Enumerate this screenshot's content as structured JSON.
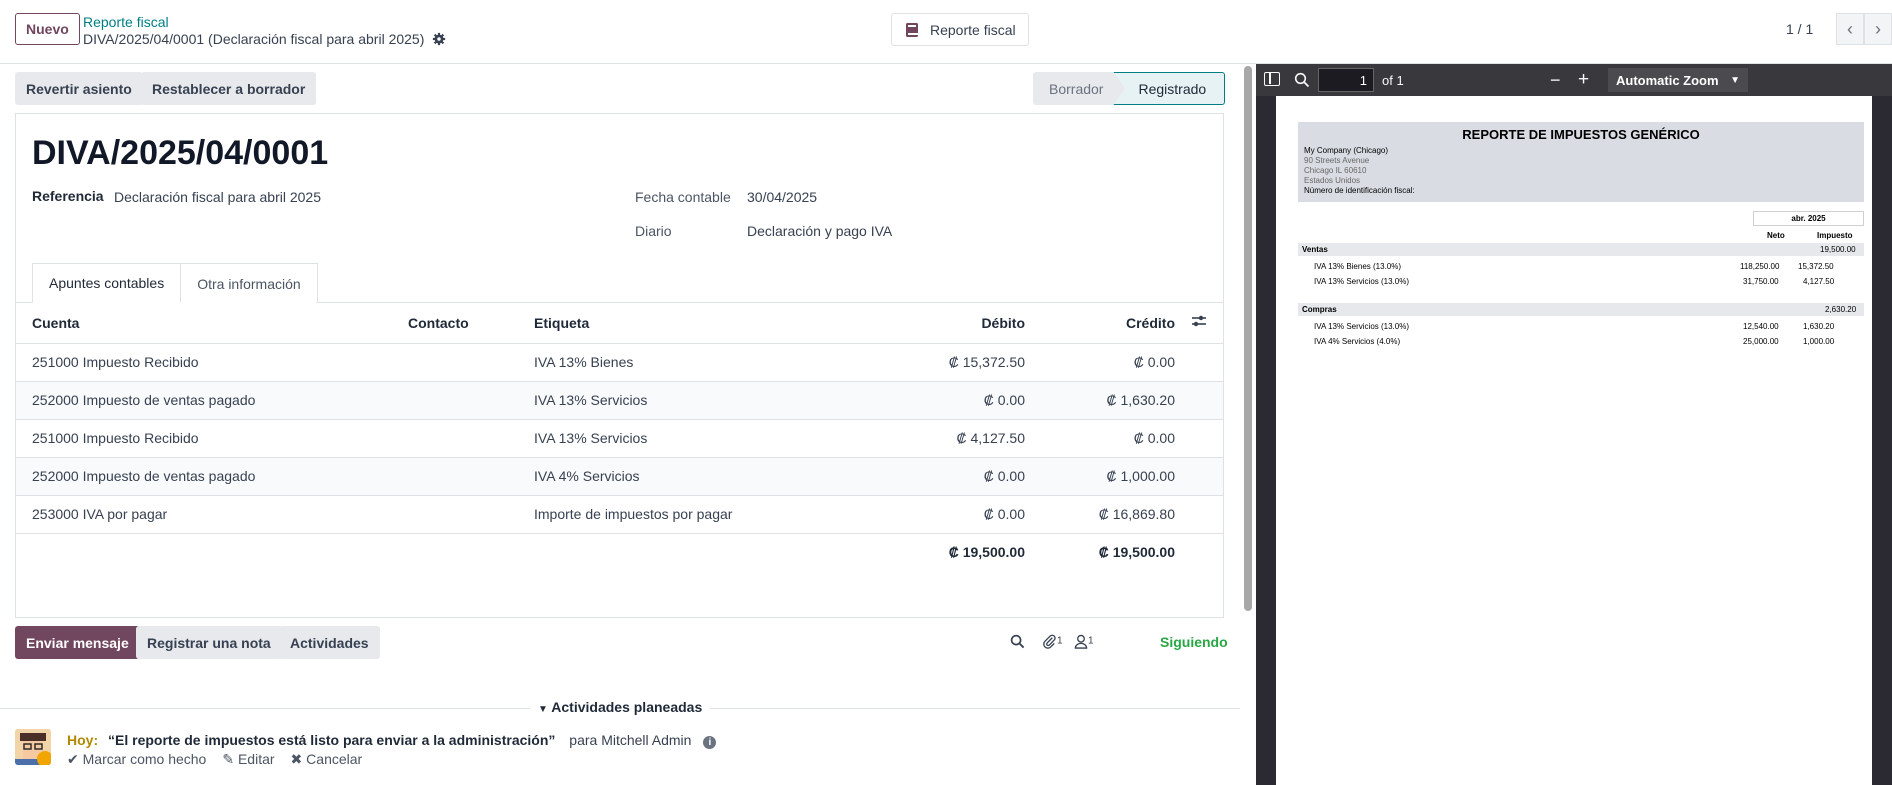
{
  "topbar": {
    "new_label": "Nuevo",
    "breadcrumb_parent": "Reporte fiscal",
    "breadcrumb_current": "DIVA/2025/04/0001 (Declaración fiscal para abril 2025)",
    "report_button": "Reporte fiscal",
    "pager": "1 / 1"
  },
  "actions": {
    "revert": "Revertir asiento",
    "reset": "Restablecer a borrador"
  },
  "status": {
    "draft": "Borrador",
    "posted": "Registrado"
  },
  "form": {
    "title": "DIVA/2025/04/0001",
    "ref_label": "Referencia",
    "ref_value": "Declaración fiscal para abril 2025",
    "date_label": "Fecha contable",
    "date_value": "30/04/2025",
    "journal_label": "Diario",
    "journal_value": "Declaración y pago IVA"
  },
  "tabs": {
    "lines": "Apuntes contables",
    "other": "Otra información"
  },
  "table": {
    "headers": [
      "Cuenta",
      "Contacto",
      "Etiqueta",
      "Débito",
      "Crédito"
    ],
    "rows": [
      {
        "account": "251000 Impuesto Recibido",
        "contact": "",
        "label": "IVA 13% Bienes",
        "debit": "₡ 15,372.50",
        "credit": "₡ 0.00"
      },
      {
        "account": "252000 Impuesto de ventas pagado",
        "contact": "",
        "label": "IVA 13% Servicios",
        "debit": "₡ 0.00",
        "credit": "₡ 1,630.20"
      },
      {
        "account": "251000 Impuesto Recibido",
        "contact": "",
        "label": "IVA 13% Servicios",
        "debit": "₡ 4,127.50",
        "credit": "₡ 0.00"
      },
      {
        "account": "252000 Impuesto de ventas pagado",
        "contact": "",
        "label": "IVA 4% Servicios",
        "debit": "₡ 0.00",
        "credit": "₡ 1,000.00"
      },
      {
        "account": "253000 IVA por pagar",
        "contact": "",
        "label": "Importe de impuestos por pagar",
        "debit": "₡ 0.00",
        "credit": "₡ 16,869.80"
      }
    ],
    "total_debit": "₡ 19,500.00",
    "total_credit": "₡ 19,500.00"
  },
  "chatter": {
    "send": "Enviar mensaje",
    "note": "Registrar una nota",
    "activities": "Actividades",
    "attachments_count": "1",
    "followers_count": "1",
    "following": "Siguiendo",
    "planned_title": "Actividades planeadas",
    "activity_day": "Hoy:",
    "activity_summary": "“El reporte de impuestos está listo para enviar a la administración”",
    "activity_for": "para Mitchell Admin",
    "mark_done": "Marcar como hecho",
    "edit": "Editar",
    "cancel": "Cancelar"
  },
  "pdf": {
    "page_number": "1",
    "page_of": "of 1",
    "zoom": "Automatic Zoom",
    "report_title": "REPORTE DE IMPUESTOS GENÉRICO",
    "company": "My Company (Chicago)",
    "address1": "90 Streets Avenue",
    "address2": "Chicago IL 60610",
    "address3": "Estados Unidos",
    "tax_id_label": "Número de identificación fiscal:",
    "period": "abr. 2025",
    "col_net": "Neto",
    "col_tax": "Impuesto",
    "sales_label": "Ventas",
    "sales_total": "19,500.00",
    "sales_rows": [
      {
        "name": "IVA 13% Bienes (13.0%)",
        "net": "118,250.00",
        "tax": "15,372.50"
      },
      {
        "name": "IVA 13% Servicios (13.0%)",
        "net": "31,750.00",
        "tax": "4,127.50"
      }
    ],
    "purchases_label": "Compras",
    "purchases_total": "2,630.20",
    "purchase_rows": [
      {
        "name": "IVA 13% Servicios (13.0%)",
        "net": "12,540.00",
        "tax": "1,630.20"
      },
      {
        "name": "IVA 4% Servicios (4.0%)",
        "net": "25,000.00",
        "tax": "1,000.00"
      }
    ]
  }
}
